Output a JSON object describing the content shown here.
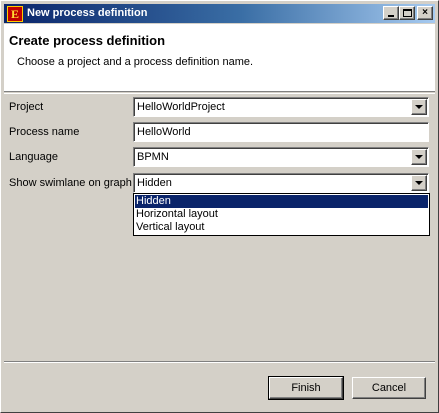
{
  "window": {
    "title": "New process definition",
    "icon_letter": "E",
    "controls": {
      "minimize": "",
      "maximize": "",
      "close": "×"
    }
  },
  "banner": {
    "title": "Create process definition",
    "description": "Choose a project and a process definition name."
  },
  "form": {
    "project": {
      "label": "Project",
      "value": "HelloWorldProject"
    },
    "process_name": {
      "label": "Process name",
      "value": "HelloWorld"
    },
    "language": {
      "label": "Language",
      "value": "BPMN"
    },
    "swimlane": {
      "label": "Show swimlane on graph",
      "value": "Hidden",
      "options": [
        "Hidden",
        "Horizontal layout",
        "Vertical layout"
      ],
      "selected_index": 0
    }
  },
  "buttons": {
    "finish": "Finish",
    "cancel": "Cancel"
  },
  "colors": {
    "title_gradient_start": "#0a246a",
    "title_gradient_end": "#a6caf0",
    "selection": "#0a246a",
    "window_face": "#d4d0c8"
  }
}
